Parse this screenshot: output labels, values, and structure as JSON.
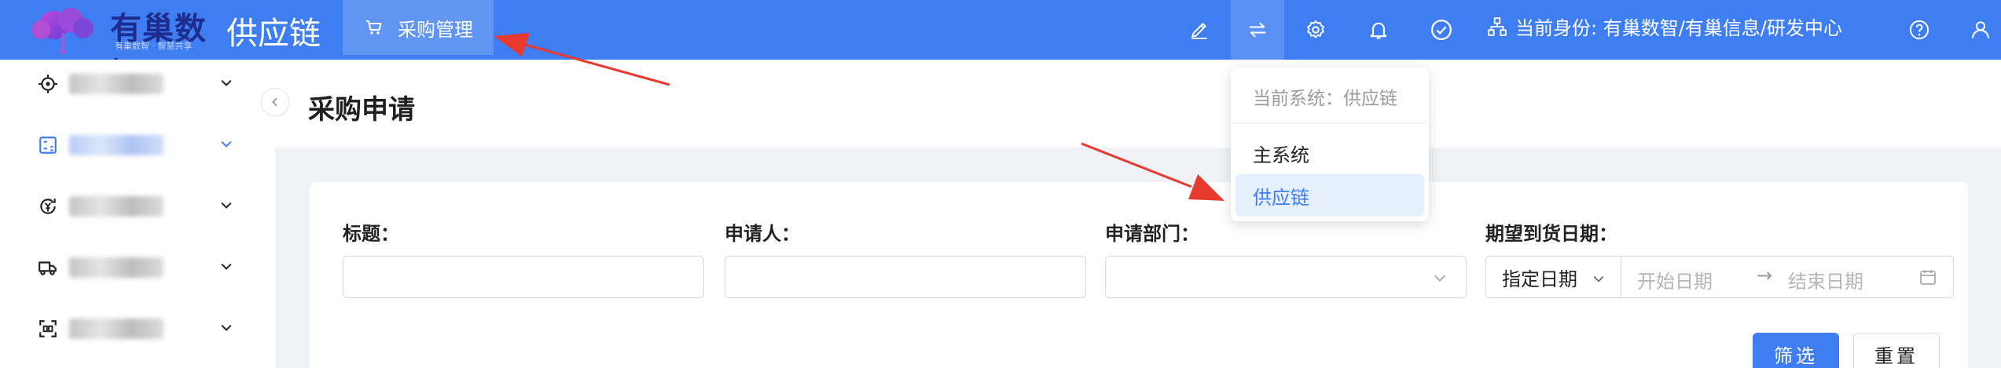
{
  "header": {
    "logo_text": "有巢数智",
    "logo_sub": "有巢数智 · 智慧共享",
    "app_title": "供应链",
    "menu_tab_label": "采购管理",
    "identity_label": "当前身份: 有巢数智/有巢信息/研发中心",
    "icons": [
      "pencil-icon",
      "switch-system-icon",
      "settings-icon",
      "bell-icon",
      "check-circle-icon",
      "org-icon",
      "help-icon",
      "user-icon"
    ]
  },
  "sidebar": {
    "items": [
      {
        "icon": "target-icon",
        "active": false
      },
      {
        "icon": "calculator-icon",
        "active": true
      },
      {
        "icon": "money-cycle-icon",
        "active": false
      },
      {
        "icon": "truck-icon",
        "active": false
      },
      {
        "icon": "scan-icon",
        "active": false
      }
    ]
  },
  "page": {
    "title": "采购申请"
  },
  "filters": {
    "title_label": "标题：",
    "applicant_label": "申请人：",
    "department_label": "申请部门：",
    "date_label": "期望到货日期：",
    "date_type": "指定日期",
    "date_start_placeholder": "开始日期",
    "date_arrow": "→",
    "date_end_placeholder": "结束日期",
    "filter_button": "筛选",
    "reset_button": "重置"
  },
  "system_dropdown": {
    "caption": "当前系统：供应链",
    "items": [
      {
        "label": "主系统",
        "selected": false
      },
      {
        "label": "供应链",
        "selected": true
      }
    ]
  },
  "colors": {
    "primary": "#3f7ef2",
    "header_bg": "#3f7ef2",
    "selected_bg": "#e6f0fd",
    "annotation_arrow": "#e8392e"
  }
}
